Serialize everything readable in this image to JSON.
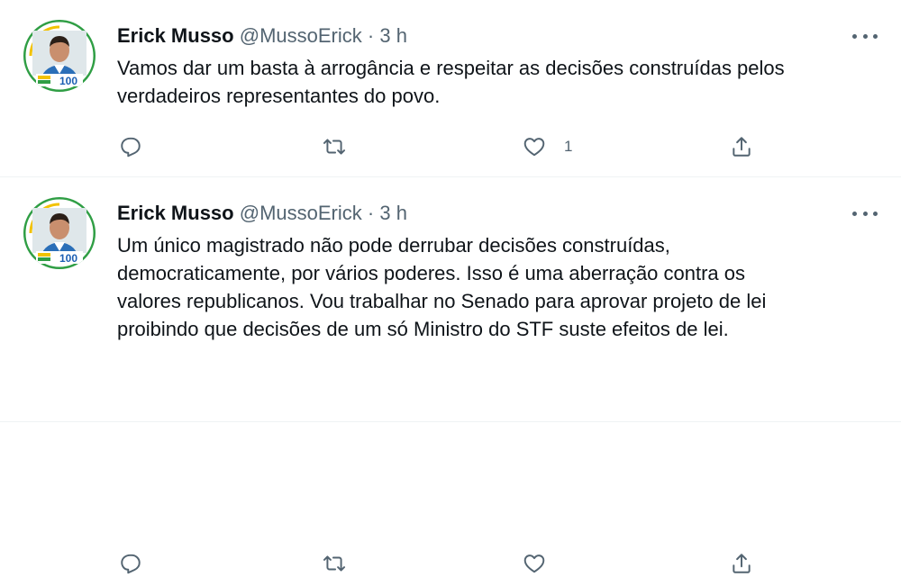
{
  "tweets": [
    {
      "name": "Erick Musso",
      "handle": "@MussoErick",
      "separator": "·",
      "time": "3 h",
      "avatar_badge": "100",
      "text_lines": [
        "Vamos dar um basta à arrogância e respeitar as decisões construídas pelos",
        "verdadeiros representantes do povo."
      ],
      "like_count": "1",
      "icons": [
        "reply-icon",
        "retweet-icon",
        "like-icon",
        "share-icon",
        "more-icon"
      ]
    },
    {
      "name": "Erick Musso",
      "handle": "@MussoErick",
      "separator": "·",
      "time": "3 h",
      "avatar_badge": "100",
      "text_lines": [
        "Um único magistrado não pode derrubar decisões construídas,",
        "democraticamente, por vários poderes. Isso é uma aberração contra os",
        "valores republicanos. Vou trabalhar no Senado para aprovar projeto de lei",
        "proibindo que decisões de um só Ministro do STF suste efeitos de lei."
      ],
      "like_count": "",
      "icons": [
        "reply-icon",
        "retweet-icon",
        "like-icon",
        "share-icon",
        "more-icon"
      ]
    }
  ],
  "colors": {
    "text": "#0f1419",
    "secondary": "#536471",
    "divider": "#eff3f4",
    "avatar_ring_green": "#2f9e44",
    "avatar_ring_yellow": "#f2c200",
    "avatar_badge_blue": "#1c5fb3"
  }
}
